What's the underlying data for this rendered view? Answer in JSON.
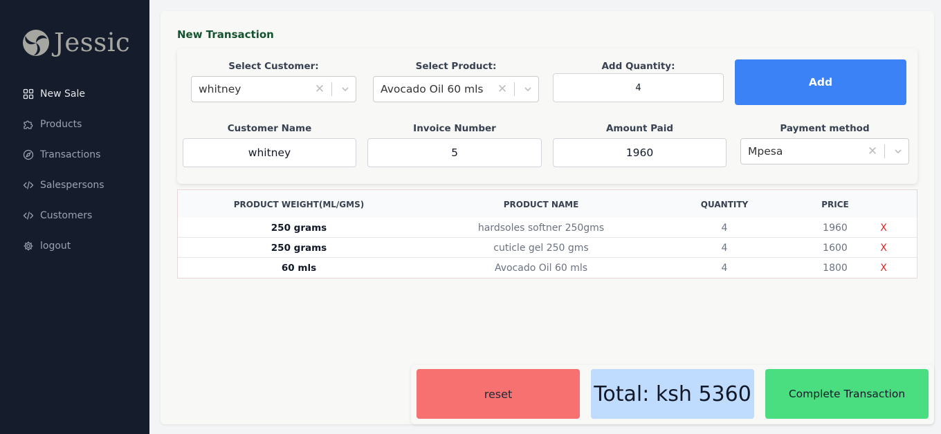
{
  "app": {
    "logo_text": "Jessic"
  },
  "sidebar": {
    "items": [
      {
        "label": "New Sale",
        "icon": "grid-icon",
        "active": true
      },
      {
        "label": "Products",
        "icon": "puzzle-icon",
        "active": false
      },
      {
        "label": "Transactions",
        "icon": "compass-icon",
        "active": false
      },
      {
        "label": "Salespersons",
        "icon": "code-icon",
        "active": false
      },
      {
        "label": "Customers",
        "icon": "code-icon",
        "active": false
      },
      {
        "label": "logout",
        "icon": "gear-icon",
        "active": false
      }
    ]
  },
  "page": {
    "title": "New Transaction"
  },
  "form": {
    "select_customer_label": "Select Customer:",
    "select_customer_value": "whitney",
    "select_product_label": "Select Product:",
    "select_product_value": "Avocado Oil 60 mls",
    "add_quantity_label": "Add Quantity:",
    "add_quantity_value": "4",
    "add_button_label": "Add",
    "customer_name_label": "Customer Name",
    "customer_name_value": "whitney",
    "invoice_number_label": "Invoice Number",
    "invoice_number_value": "5",
    "amount_paid_label": "Amount Paid",
    "amount_paid_value": "1960",
    "payment_method_label": "Payment method",
    "payment_method_value": "Mpesa"
  },
  "table": {
    "headers": [
      "PRODUCT WEIGHT(ML/GMS)",
      "PRODUCT NAME",
      "QUANTITY",
      "PRICE"
    ],
    "remove_symbol": "X",
    "rows": [
      {
        "weight": "250 grams",
        "name": "hardsoles softner 250gms",
        "quantity": "4",
        "price": "1960"
      },
      {
        "weight": "250 grams",
        "name": "cuticle gel 250 gms",
        "quantity": "4",
        "price": "1600"
      },
      {
        "weight": "60 mls",
        "name": "Avocado Oil 60 mls",
        "quantity": "4",
        "price": "1800"
      }
    ]
  },
  "footer": {
    "reset_label": "reset",
    "total_label": "Total: ksh 5360",
    "complete_label": "Complete Transaction"
  },
  "colors": {
    "sidebar_bg": "#151c2c",
    "title_green": "#14532d",
    "add_button": "#3b82f6",
    "reset_button": "#f87171",
    "total_box": "#bfdbfe",
    "complete_button": "#4ade80",
    "remove_red": "#dc2626"
  }
}
